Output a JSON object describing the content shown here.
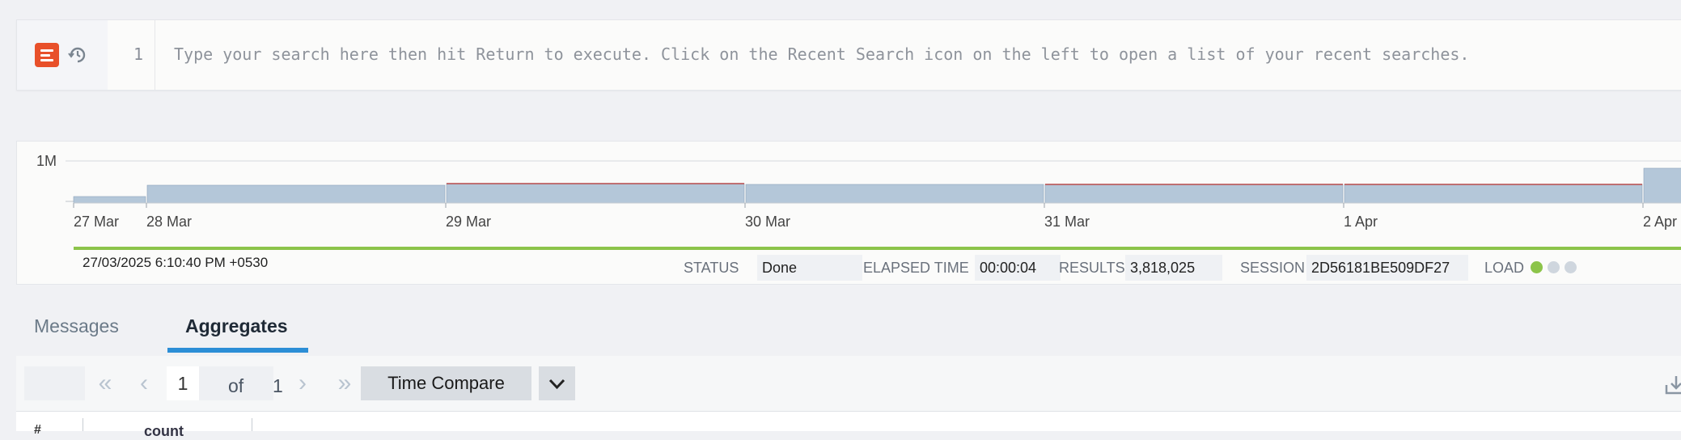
{
  "search": {
    "line_number": "1",
    "placeholder": "Type your search here then hit Return to execute. Click on the Recent Search icon on the left to open a list of your recent searches."
  },
  "histogram": {
    "y_tick_label": "1M",
    "x_tick_labels": [
      "27 Mar",
      "28 Mar",
      "29 Mar",
      "30 Mar",
      "31 Mar",
      "1 Apr",
      "2 Apr"
    ]
  },
  "status_bar": {
    "start_time": "27/03/2025 6:10:40 PM +0530",
    "status_label": "STATUS",
    "status_value": "Done",
    "elapsed_label": "ELAPSED TIME",
    "elapsed_value": "00:00:04",
    "results_label": "RESULTS",
    "results_value": "3,818,025",
    "session_label": "SESSION",
    "session_value": "2D56181BE509DF27",
    "load_label": "LOAD",
    "load_dot_colors": [
      "#8cc44a",
      "#cfd6de",
      "#cfd6de"
    ]
  },
  "tabs": [
    {
      "label": "Messages",
      "active": false
    },
    {
      "label": "Aggregates",
      "active": true
    }
  ],
  "pager": {
    "current_page": "1",
    "of_label": "of",
    "total_pages": "1",
    "time_compare_label": "Time Compare"
  },
  "table": {
    "columns": [
      "#",
      "count"
    ]
  },
  "colors": {
    "brand_orange": "#e8502a",
    "bar_fill": "#b4c7d9",
    "accent_blue": "#2c8ed6",
    "progress_green": "#8cc44a"
  }
}
